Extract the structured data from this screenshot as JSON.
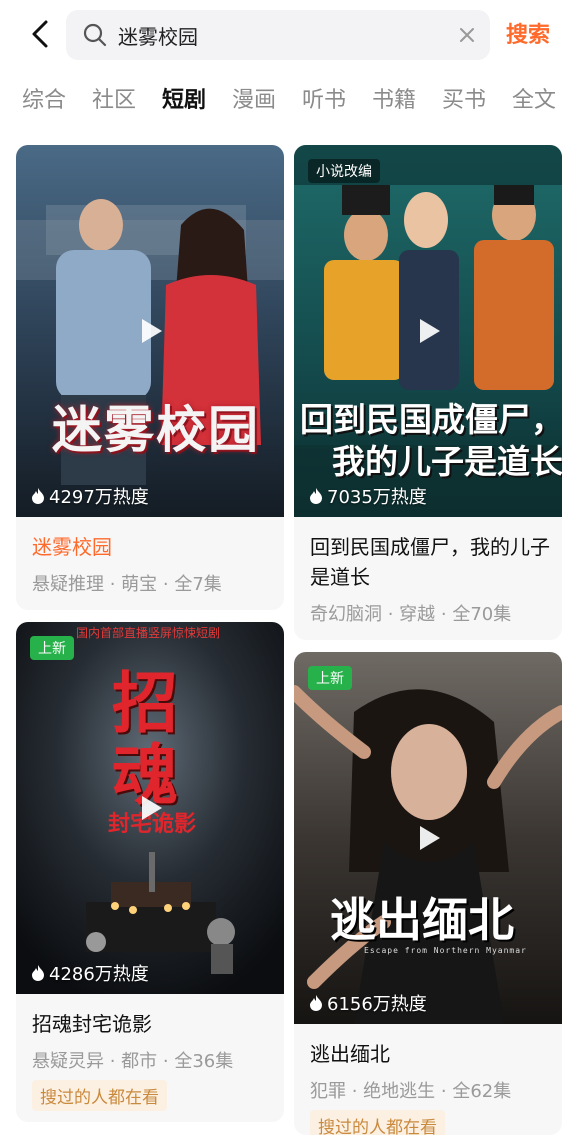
{
  "search": {
    "query": "迷雾校园",
    "button_label": "搜索"
  },
  "tabs": [
    {
      "label": "综合",
      "active": false
    },
    {
      "label": "社区",
      "active": false
    },
    {
      "label": "短剧",
      "active": true
    },
    {
      "label": "漫画",
      "active": false
    },
    {
      "label": "听书",
      "active": false
    },
    {
      "label": "书籍",
      "active": false
    },
    {
      "label": "买书",
      "active": false
    },
    {
      "label": "全文",
      "active": false
    }
  ],
  "cards": [
    {
      "title": "迷雾校园",
      "cover_text": "迷雾校园",
      "heat": "4297万热度",
      "meta": "悬疑推理 · 萌宝 · 全7集",
      "title_color": "#ff6a2b"
    },
    {
      "badge": "小说改编",
      "title": "回到民国成僵尸，我的儿子是道长",
      "cover_text_1": "回到民国成僵尸，",
      "cover_text_2": "我的儿子是道长",
      "heat": "7035万热度",
      "meta": "奇幻脑洞 · 穿越 · 全70集"
    },
    {
      "badge": "上新",
      "top_caption": "国内首部直播竖屏惊悚短剧",
      "cover_text_1": "招",
      "cover_text_2": "魂",
      "cover_text_3": "封宅诡影",
      "title": "招魂封宅诡影",
      "heat": "4286万热度",
      "meta": "悬疑灵异 · 都市 · 全36集",
      "tag": "搜过的人都在看"
    },
    {
      "badge": "上新",
      "cover_text": "逃出缅北",
      "cover_subtext": "Escape from Northern Myanmar",
      "title": "逃出缅北",
      "heat": "6156万热度",
      "meta": "犯罪 · 绝地逃生 · 全62集",
      "tag": "搜过的人都在看"
    }
  ],
  "colors": {
    "accent": "#ff6a2b",
    "new_badge": "#27b14a",
    "tag_bg": "#fcf0e2",
    "tag_text": "#c98a3e"
  }
}
